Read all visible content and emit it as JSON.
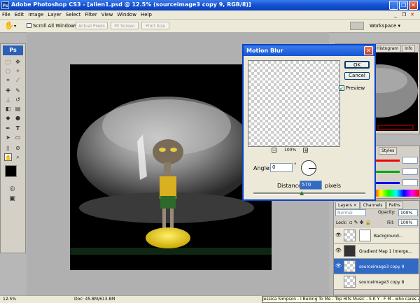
{
  "window": {
    "title": "Adobe Photoshop CS3 - [alien1.psd @ 12.5% (sourceimage3 copy 9, RGB/8)]",
    "app_badge": "Ps"
  },
  "window_controls": {
    "minimize": "_",
    "restore": "❐",
    "close": "✕"
  },
  "menu": [
    "File",
    "Edit",
    "Image",
    "Layer",
    "Select",
    "Filter",
    "View",
    "Window",
    "Help"
  ],
  "doc_controls": {
    "minimize": "_",
    "restore": "❐",
    "close": "✕"
  },
  "options": {
    "scroll_all_windows": "Scroll All Windows",
    "actual_pixels": "Actual Pixels",
    "fit_screen": "Fit Screen",
    "print_size": "Print Size",
    "workspace": "Workspace ▾"
  },
  "tools": {
    "badge": "Ps"
  },
  "status": {
    "zoom": "12.5%",
    "doc": "Doc: 45.8M/613.8M",
    "now_playing": "Jessica Simpson - I Belong To Me - Top Hits Music - S K Y . F M - who cares abo"
  },
  "navigator": {
    "tabs": [
      "Histogram",
      "Info"
    ]
  },
  "swatches": {
    "tabs": [
      "Styles"
    ]
  },
  "dialog": {
    "title": "Motion Blur",
    "ok": "OK",
    "cancel": "Cancel",
    "preview_label": "Preview",
    "preview_checked": true,
    "zoom_out": "−",
    "zoom_level": "100%",
    "zoom_in": "+",
    "angle_label": "Angle:",
    "angle_value": "0",
    "angle_unit": "°",
    "distance_label": "Distance:",
    "distance_value": "570",
    "distance_unit": "pixels"
  },
  "layers": {
    "tabs": [
      "Layers ×",
      "Channels",
      "Paths"
    ],
    "blend_mode": "Normal",
    "opacity_label": "Opacity:",
    "opacity_value": "100%",
    "lock_label": "Lock:",
    "fill_label": "Fill:",
    "fill_value": "100%",
    "items": [
      {
        "name": "Background...",
        "visible": true,
        "selected": false
      },
      {
        "name": "Gradient Map 1 (merge...",
        "visible": true,
        "selected": false
      },
      {
        "name": "sourceimage3 copy 9",
        "visible": true,
        "selected": true
      },
      {
        "name": "sourceimage3 copy 8",
        "visible": false,
        "selected": false
      }
    ]
  }
}
